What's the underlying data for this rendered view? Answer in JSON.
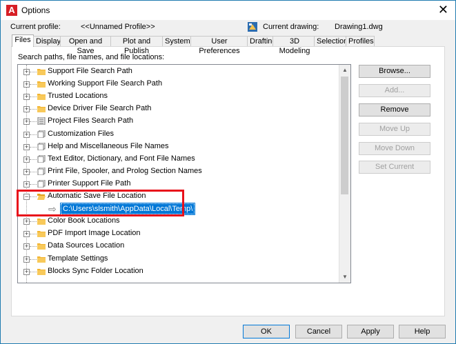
{
  "window": {
    "title": "Options",
    "close_glyph": "✕"
  },
  "profile": {
    "current_profile_label": "Current profile:",
    "current_profile_value": "<<Unnamed Profile>>",
    "current_drawing_label": "Current drawing:",
    "current_drawing_value": "Drawing1.dwg"
  },
  "tabs": [
    "Files",
    "Display",
    "Open and Save",
    "Plot and Publish",
    "System",
    "User Preferences",
    "Drafting",
    "3D Modeling",
    "Selection",
    "Profiles"
  ],
  "active_tab": "Files",
  "files": {
    "section_label": "Search paths, file names, and file locations:",
    "tree": [
      {
        "label": "Support File Search Path",
        "icon": "folder-icon"
      },
      {
        "label": "Working Support File Search Path",
        "icon": "folder-icon"
      },
      {
        "label": "Trusted Locations",
        "icon": "folder-icon"
      },
      {
        "label": "Device Driver File Search Path",
        "icon": "folder-icon"
      },
      {
        "label": "Project Files Search Path",
        "icon": "project-files-icon"
      },
      {
        "label": "Customization Files",
        "icon": "document-stack-icon"
      },
      {
        "label": "Help and Miscellaneous File Names",
        "icon": "document-stack-icon"
      },
      {
        "label": "Text Editor, Dictionary, and Font File Names",
        "icon": "document-stack-icon"
      },
      {
        "label": "Print File, Spooler, and Prolog Section Names",
        "icon": "document-stack-icon"
      },
      {
        "label": "Printer Support File Path",
        "icon": "document-stack-icon"
      },
      {
        "label": "Automatic Save File Location",
        "icon": "folder-open-icon",
        "expanded": true
      },
      {
        "label": "Color Book Locations",
        "icon": "folder-icon"
      },
      {
        "label": "PDF Import Image Location",
        "icon": "folder-icon"
      },
      {
        "label": "Data Sources Location",
        "icon": "folder-icon"
      },
      {
        "label": "Template Settings",
        "icon": "folder-icon"
      },
      {
        "label": "Blocks Sync Folder Location",
        "icon": "folder-icon"
      }
    ],
    "autosave_path": "C:\\Users\\slsmith\\AppData\\Local\\Temp\\",
    "buttons": {
      "browse": "Browse...",
      "add": "Add...",
      "remove": "Remove",
      "move_up": "Move Up",
      "move_down": "Move Down",
      "set_current": "Set Current"
    }
  },
  "footer": {
    "ok": "OK",
    "cancel": "Cancel",
    "apply": "Apply",
    "help": "Help"
  },
  "colors": {
    "selection": "#0078d7",
    "highlight_box": "#e8101a",
    "app_icon": "#d71f26",
    "folder": "#f2b431"
  }
}
